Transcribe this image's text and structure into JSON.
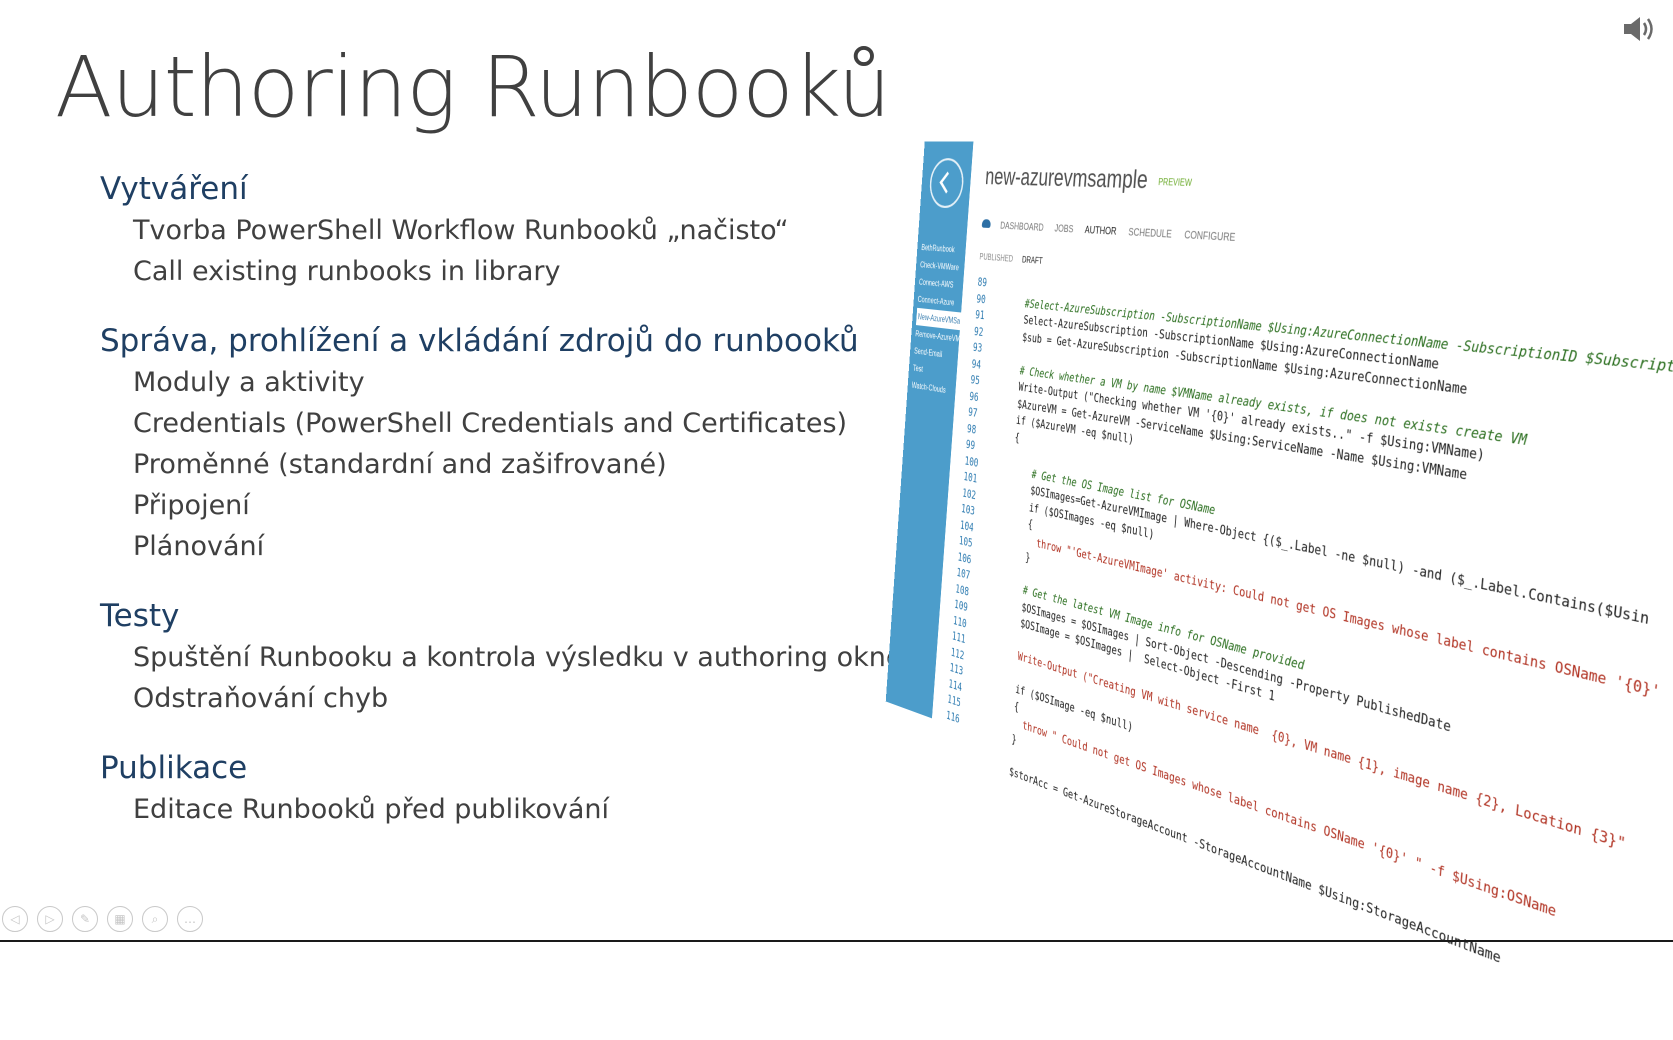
{
  "slide": {
    "title": "Authoring Runbooků",
    "sections": [
      {
        "heading": "Vytváření",
        "items": [
          "Tvorba PowerShell Workflow Runbooků „načisto“",
          "Call existing runbooks in library"
        ]
      },
      {
        "heading": "Správa, prohlížení a vkládání zdrojů do runbooků",
        "items": [
          "Moduly a aktivity",
          "Credentials (PowerShell Credentials and Certificates)",
          "Proměnné (standardní and zašifrované)",
          "Připojení",
          "Plánování"
        ]
      },
      {
        "heading": "Testy",
        "items": [
          "Spuštění Runbooku a kontrola výsledku v authoring okně",
          "Odstraňování chyb"
        ]
      },
      {
        "heading": "Publikace",
        "items": [
          "Editace Runbooků před publikování"
        ]
      }
    ]
  },
  "screenshot": {
    "nav_items": [
      "BethRunbook",
      "Check-VMWare",
      "Connect-AWS",
      "Connect-Azure",
      "New-AzureVMSa...",
      "Remove-AzureVM...",
      "Send-Email",
      "Test",
      "Watch-Clouds"
    ],
    "active_nav_index": 4,
    "title": "new-azurevmsample",
    "preview_badge": "PREVIEW",
    "tabs": [
      "DASHBOARD",
      "JOBS",
      "AUTHOR",
      "SCHEDULE",
      "CONFIGURE"
    ],
    "active_tab_index": 2,
    "subtabs": [
      "PUBLISHED",
      "DRAFT"
    ],
    "active_subtab_index": 1,
    "code_lines": [
      {
        "n": "89",
        "t": "",
        "k": "normal"
      },
      {
        "n": "90",
        "t": "    #Select-AzureSubscription -SubscriptionName $Using:AzureConnectionName -SubscriptionID $Subscript",
        "k": "comment"
      },
      {
        "n": "91",
        "t": "    Select-AzureSubscription -SubscriptionName $Using:AzureConnectionName",
        "k": "normal"
      },
      {
        "n": "92",
        "t": "    $sub = Get-AzureSubscription -SubscriptionName $Using:AzureConnectionName",
        "k": "normal"
      },
      {
        "n": "93",
        "t": "",
        "k": "normal"
      },
      {
        "n": "94",
        "t": "    # Check whether a VM by name $VMName already exists, if does not exists create VM",
        "k": "comment"
      },
      {
        "n": "95",
        "t": "    Write-Output (\"Checking whether VM '{0}' already exists..\" -f $Using:VMName)",
        "k": "normal"
      },
      {
        "n": "96",
        "t": "    $AzureVM = Get-AzureVM -ServiceName $Using:ServiceName -Name $Using:VMName",
        "k": "normal"
      },
      {
        "n": "97",
        "t": "    if ($AzureVM -eq $null)",
        "k": "normal"
      },
      {
        "n": "98",
        "t": "    {",
        "k": "normal"
      },
      {
        "n": "99",
        "t": "",
        "k": "normal"
      },
      {
        "n": "100",
        "t": "        # Get the OS Image list for OSName",
        "k": "comment"
      },
      {
        "n": "101",
        "t": "        $OSImages=Get-AzureVMImage | Where-Object {($_.Label -ne $null) -and ($_.Label.Contains($Usin",
        "k": "normal"
      },
      {
        "n": "102",
        "t": "        if ($OSImages -eq $null)",
        "k": "normal"
      },
      {
        "n": "103",
        "t": "        {",
        "k": "normal"
      },
      {
        "n": "104",
        "t": "          throw \"'Get-AzureVMImage' activity: Could not get OS Images whose label contains OSName '{0}'",
        "k": "string"
      },
      {
        "n": "105",
        "t": "        }",
        "k": "normal"
      },
      {
        "n": "106",
        "t": "",
        "k": "normal"
      },
      {
        "n": "107",
        "t": "        # Get the latest VM Image info for OSName provided",
        "k": "comment"
      },
      {
        "n": "108",
        "t": "        $OSImages = $OSImages | Sort-Object -Descending -Property PublishedDate",
        "k": "normal"
      },
      {
        "n": "109",
        "t": "        $OSImage = $OSImages |  Select-Object -First 1",
        "k": "normal"
      },
      {
        "n": "110",
        "t": "",
        "k": "normal"
      },
      {
        "n": "111",
        "t": "        Write-Output (\"Creating VM with service name  {0}, VM name {1}, image name {2}, Location {3}\"",
        "k": "string"
      },
      {
        "n": "112",
        "t": "",
        "k": "normal"
      },
      {
        "n": "113",
        "t": "        if ($OSImage -eq $null)",
        "k": "normal"
      },
      {
        "n": "114",
        "t": "        {",
        "k": "normal"
      },
      {
        "n": "115",
        "t": "          throw \" Could not get OS Images whose label contains OSName '{0}' \" -f $Using:OSName",
        "k": "string"
      },
      {
        "n": "116",
        "t": "        }",
        "k": "normal"
      },
      {
        "n": "",
        "t": "",
        "k": "normal"
      },
      {
        "n": "",
        "t": "        $storAcc = Get-AzureStorageAccount -StorageAccountName $Using:StorageAccountName",
        "k": "normal"
      }
    ]
  },
  "icons": {
    "speaker": "speaker-icon",
    "controls": [
      "previous-slide-icon",
      "next-slide-icon",
      "pen-icon",
      "slides-grid-icon",
      "zoom-icon",
      "more-options-icon"
    ]
  },
  "colors": {
    "heading": "#1f3f63",
    "body_text": "#404040",
    "title": "#404040",
    "nav_blue": "#4c9dcb"
  }
}
